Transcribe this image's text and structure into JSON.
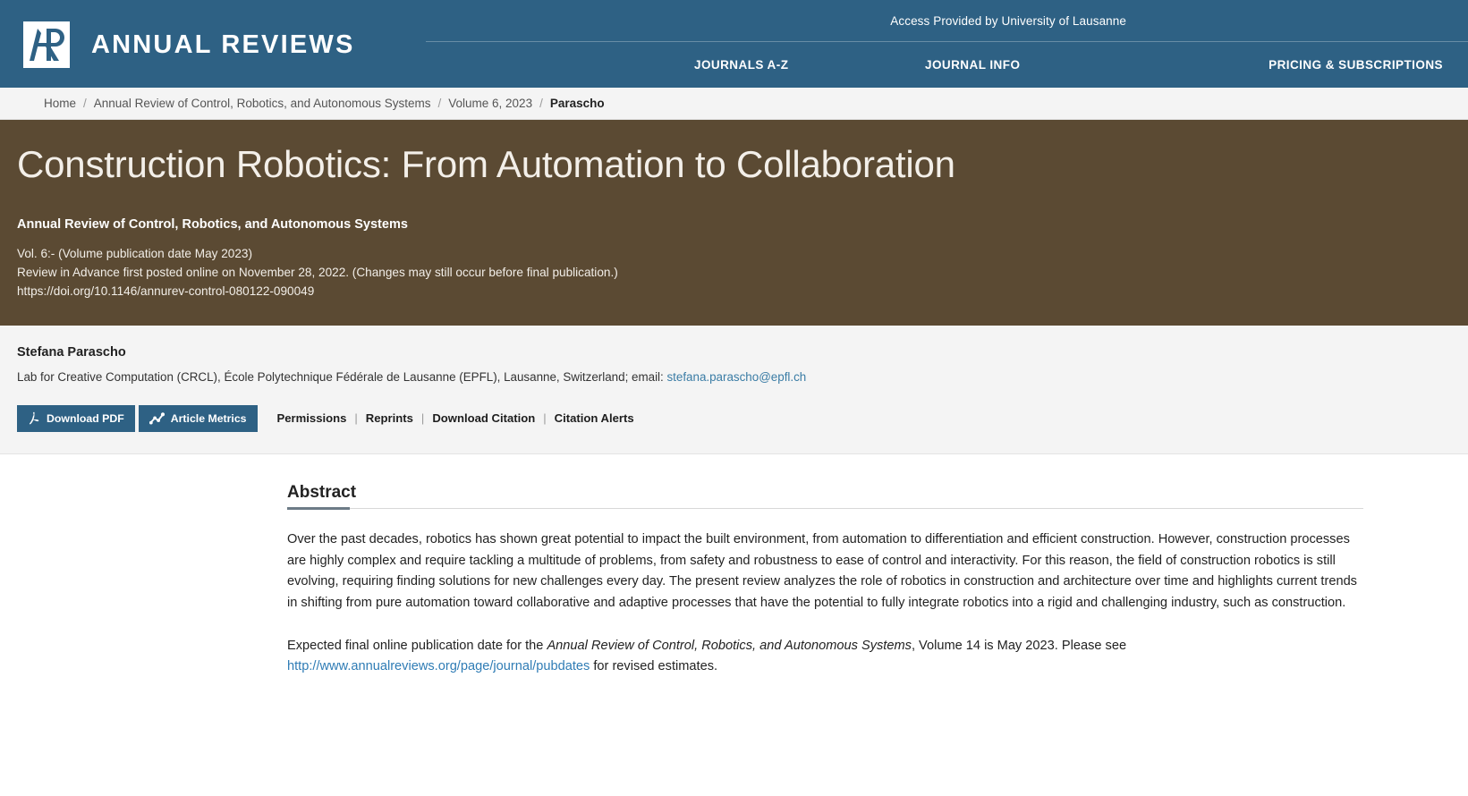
{
  "header": {
    "access_text": "Access Provided by University of Lausanne",
    "logo_text": "ANNUAL REVIEWS",
    "nav": [
      {
        "label": "JOURNALS A-Z"
      },
      {
        "label": "JOURNAL INFO"
      },
      {
        "label": "PRICING & SUBSCRIPTIONS"
      }
    ],
    "brand_color": "#2e6184"
  },
  "breadcrumb": {
    "separator": "/",
    "items": [
      {
        "label": "Home"
      },
      {
        "label": "Annual Review of Control, Robotics, and Autonomous Systems"
      },
      {
        "label": "Volume 6, 2023"
      },
      {
        "label": "Parascho"
      }
    ]
  },
  "title_banner": {
    "background_color": "#5b4a33",
    "title": "Construction Robotics: From Automation to Collaboration",
    "journal_name": "Annual Review of Control, Robotics, and Autonomous Systems",
    "volume_line": "Vol. 6:- (Volume publication date May 2023)",
    "advance_line": "Review in Advance first posted online on November 28, 2022. (Changes may still occur before final publication.)",
    "doi": "https://doi.org/10.1146/annurev-control-080122-090049"
  },
  "author": {
    "name": "Stefana Parascho",
    "affiliation_before_email": "Lab for Creative Computation (CRCL), École Polytechnique Fédérale de Lausanne (EPFL), Lausanne, Switzerland; email: ",
    "email": "stefana.parascho@epfl.ch"
  },
  "toolbar": {
    "download_pdf_label": "Download PDF",
    "article_metrics_label": "Article Metrics",
    "links": [
      {
        "label": "Permissions"
      },
      {
        "label": "Reprints"
      },
      {
        "label": "Download Citation"
      },
      {
        "label": "Citation Alerts"
      }
    ],
    "link_separator": "|"
  },
  "abstract": {
    "heading": "Abstract",
    "paragraph_1": "Over the past decades, robotics has shown great potential to impact the built environment, from automation to differentiation and efficient construction. However, construction processes are highly complex and require tackling a multitude of problems, from safety and robustness to ease of control and interactivity. For this reason, the field of construction robotics is still evolving, requiring finding solutions for new challenges every day. The present review analyzes the role of robotics in construction and architecture over time and highlights current trends in shifting from pure automation toward collaborative and adaptive processes that have the potential to fully integrate robotics into a rigid and challenging industry, such as construction.",
    "paragraph_2_pre": "Expected final online publication date for the ",
    "paragraph_2_italic": "Annual Review of Control, Robotics, and Autonomous Systems",
    "paragraph_2_mid": ", Volume 14 is May 2023. Please see ",
    "paragraph_2_link": "http://www.annualreviews.org/page/journal/pubdates",
    "paragraph_2_post": " for revised estimates."
  }
}
